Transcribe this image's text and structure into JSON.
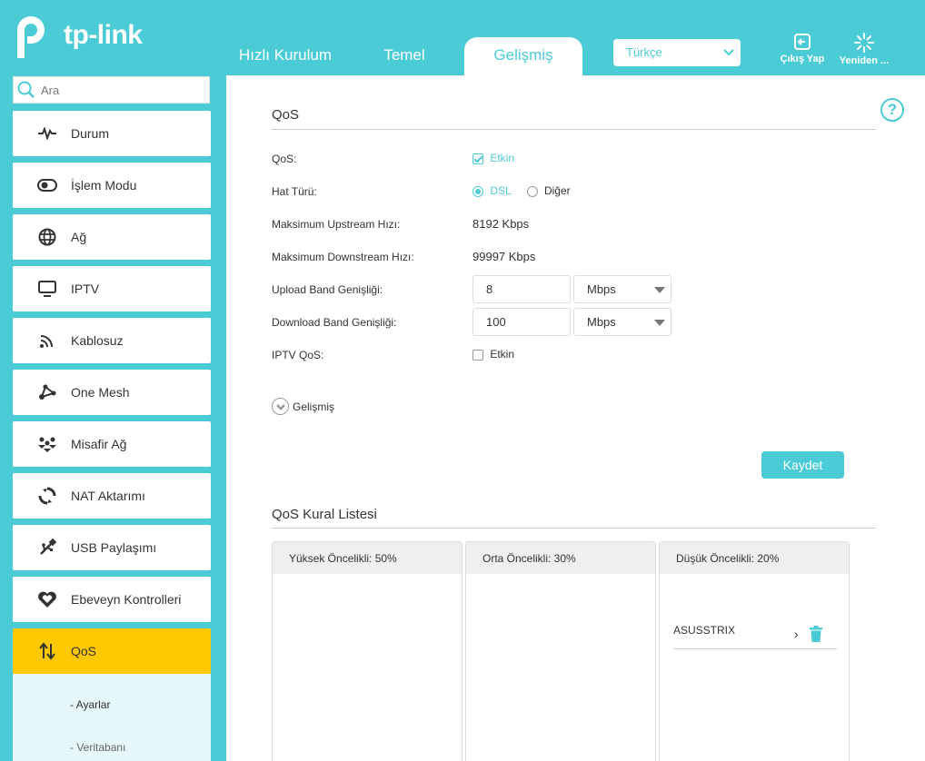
{
  "brand": {
    "name": "tp-link",
    "accent": "#4acbd6",
    "active_nav": "#ffc800"
  },
  "nav": {
    "tabs": [
      "Hızlı Kurulum",
      "Temel",
      "Gelişmiş"
    ],
    "language": "Türkçe",
    "logout_label": "Çıkış Yap",
    "reboot_label": "Yeniden ..."
  },
  "sidebar": {
    "search_placeholder": "Ara",
    "items": [
      {
        "label": "Durum",
        "icon": "pulse-icon"
      },
      {
        "label": "İşlem Modu",
        "icon": "toggle-icon"
      },
      {
        "label": "Ağ",
        "icon": "globe-icon"
      },
      {
        "label": "IPTV",
        "icon": "monitor-icon"
      },
      {
        "label": "Kablosuz",
        "icon": "wireless-icon"
      },
      {
        "label": "One Mesh",
        "icon": "mesh-icon"
      },
      {
        "label": "Misafir Ağ",
        "icon": "guests-icon"
      },
      {
        "label": "NAT Aktarımı",
        "icon": "nat-icon"
      },
      {
        "label": "USB Paylaşımı",
        "icon": "usb-icon"
      },
      {
        "label": "Ebeveyn Kontrolleri",
        "icon": "heart-icon"
      },
      {
        "label": "QoS",
        "icon": "updown-arrows-icon"
      }
    ],
    "sub_items": [
      "- Ayarlar",
      "- Veritabanı"
    ]
  },
  "qos": {
    "title": "QoS",
    "qos_label": "QoS:",
    "qos_enabled_label": "Etkin",
    "line_type_label": "Hat Türü:",
    "line_type_options": [
      "DSL",
      "Diğer"
    ],
    "max_up_label": "Maksimum Upstream Hızı:",
    "max_up_value": "8192 Kbps",
    "max_down_label": "Maksimum Downstream Hızı:",
    "max_down_value": "99997 Kbps",
    "upload_label": "Upload Band Genişliği:",
    "upload_value": "8",
    "upload_unit": "Mbps",
    "download_label": "Download Band Genişliği:",
    "download_value": "100",
    "download_unit": "Mbps",
    "iptv_label": "IPTV QoS:",
    "iptv_enabled_label": "Etkin",
    "advanced_label": "Gelişmiş",
    "save_label": "Kaydet"
  },
  "rules": {
    "title": "QoS Kural Listesi",
    "columns": [
      {
        "label": "Yüksek Öncelikli: 50%",
        "items": []
      },
      {
        "label": "Orta Öncelikli: 30%",
        "items": []
      },
      {
        "label": "Düşük Öncelikli: 20%",
        "items": [
          "ASUSSTRIX"
        ]
      }
    ]
  }
}
